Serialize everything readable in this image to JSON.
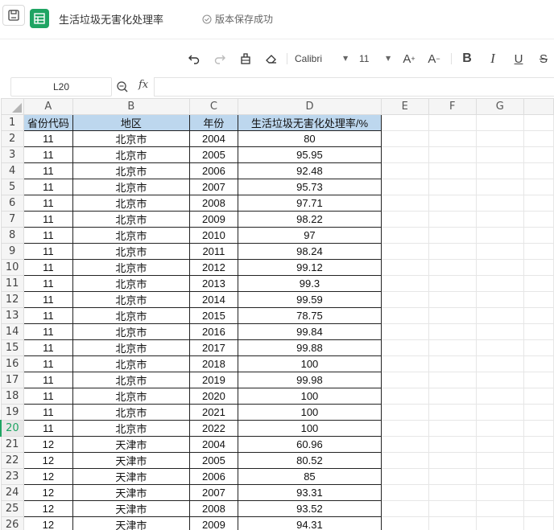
{
  "title_bar": {
    "doc_title": "生活垃圾无害化处理率",
    "save_status": "版本保存成功"
  },
  "toolbar": {
    "font_name": "Calibri",
    "font_size": "11"
  },
  "formula_bar": {
    "cell_ref": "L20",
    "fx_label": "fx",
    "value": ""
  },
  "sheet": {
    "active_row": 20,
    "columns": [
      "A",
      "B",
      "C",
      "D",
      "E",
      "F",
      "G"
    ],
    "header": [
      "省份代码",
      "地区",
      "年份",
      "生活垃圾无害化处理率/%"
    ],
    "rows": [
      [
        "11",
        "北京市",
        "2004",
        "80"
      ],
      [
        "11",
        "北京市",
        "2005",
        "95.95"
      ],
      [
        "11",
        "北京市",
        "2006",
        "92.48"
      ],
      [
        "11",
        "北京市",
        "2007",
        "95.73"
      ],
      [
        "11",
        "北京市",
        "2008",
        "97.71"
      ],
      [
        "11",
        "北京市",
        "2009",
        "98.22"
      ],
      [
        "11",
        "北京市",
        "2010",
        "97"
      ],
      [
        "11",
        "北京市",
        "2011",
        "98.24"
      ],
      [
        "11",
        "北京市",
        "2012",
        "99.12"
      ],
      [
        "11",
        "北京市",
        "2013",
        "99.3"
      ],
      [
        "11",
        "北京市",
        "2014",
        "99.59"
      ],
      [
        "11",
        "北京市",
        "2015",
        "78.75"
      ],
      [
        "11",
        "北京市",
        "2016",
        "99.84"
      ],
      [
        "11",
        "北京市",
        "2017",
        "99.88"
      ],
      [
        "11",
        "北京市",
        "2018",
        "100"
      ],
      [
        "11",
        "北京市",
        "2019",
        "99.98"
      ],
      [
        "11",
        "北京市",
        "2020",
        "100"
      ],
      [
        "11",
        "北京市",
        "2021",
        "100"
      ],
      [
        "11",
        "北京市",
        "2022",
        "100"
      ],
      [
        "12",
        "天津市",
        "2004",
        "60.96"
      ],
      [
        "12",
        "天津市",
        "2005",
        "80.52"
      ],
      [
        "12",
        "天津市",
        "2006",
        "85"
      ],
      [
        "12",
        "天津市",
        "2007",
        "93.31"
      ],
      [
        "12",
        "天津市",
        "2008",
        "93.52"
      ],
      [
        "12",
        "天津市",
        "2009",
        "94.31"
      ]
    ]
  }
}
